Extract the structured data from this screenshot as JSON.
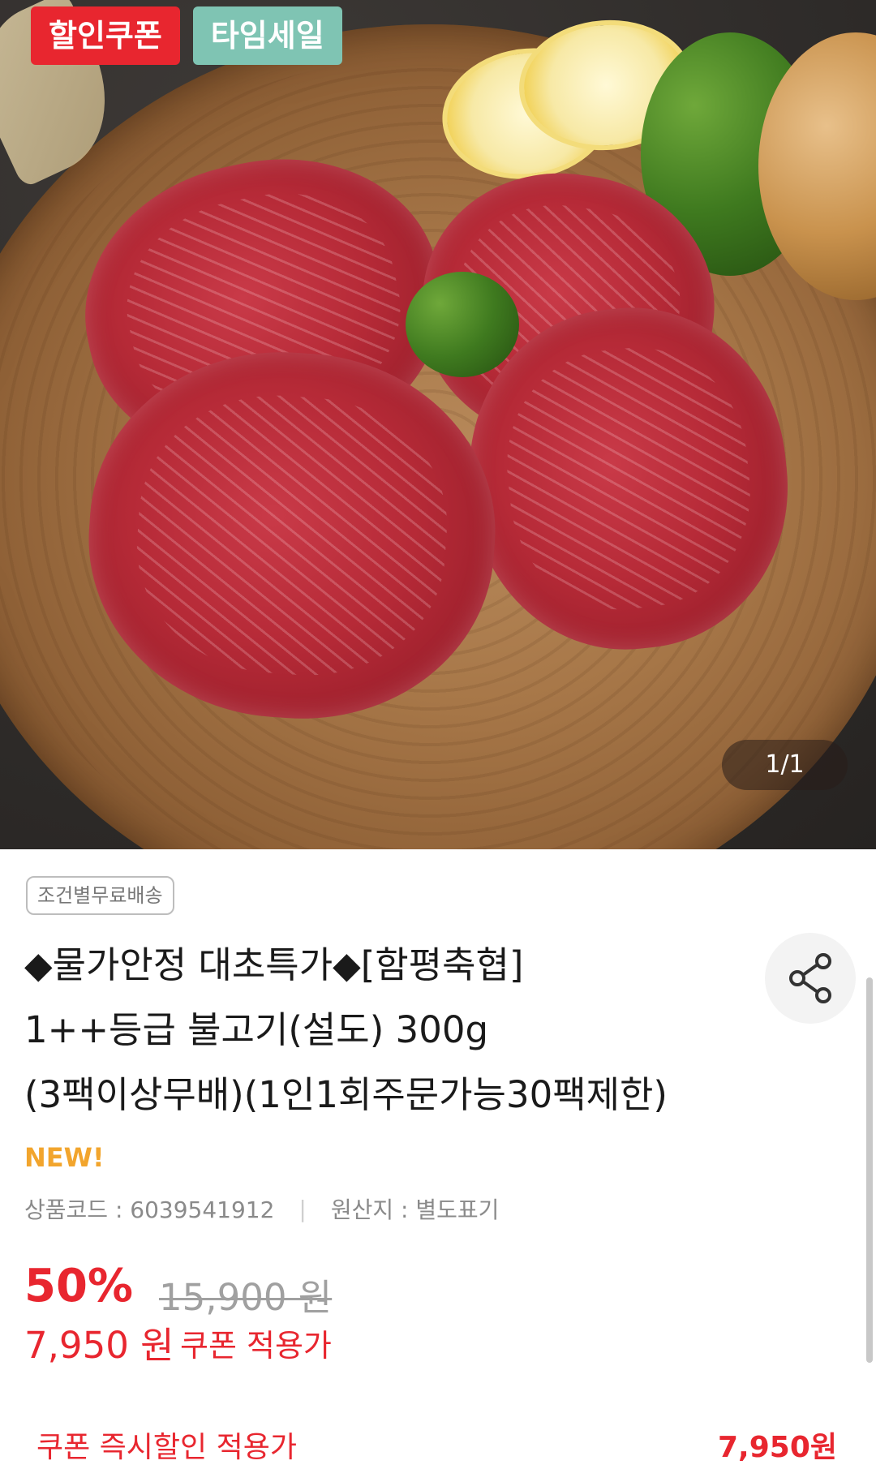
{
  "image": {
    "badges": [
      {
        "label": "할인쿠폰",
        "color": "#e8262f"
      },
      {
        "label": "타임세일",
        "color": "#7fc4b3"
      }
    ],
    "page_indicator": "1/1"
  },
  "product": {
    "shipping_tag": "조건별무료배송",
    "title_lines": [
      "◆물가안정 대초특가◆[함평축협]",
      "1++등급 불고기(설도) 300g",
      "(3팩이상무배)(1인1회주문가능30팩제한)"
    ],
    "new_label": "NEW!",
    "product_code": "상품코드 : 6039541912",
    "origin": "원산지 : 별도표기",
    "meta_separator": "|",
    "discount_rate": "50%",
    "original_price": "15,900 원",
    "sale_price": "7,950 원",
    "sale_price_note": "쿠폰 적용가",
    "coupon_row": {
      "label": "쿠폰 즉시할인 적용가",
      "price": "7,950원"
    }
  },
  "icons": {
    "share": "share-icon"
  },
  "colors": {
    "accent_red": "#e8262f",
    "new_orange": "#f2a52d",
    "mint": "#7fc4b3"
  }
}
